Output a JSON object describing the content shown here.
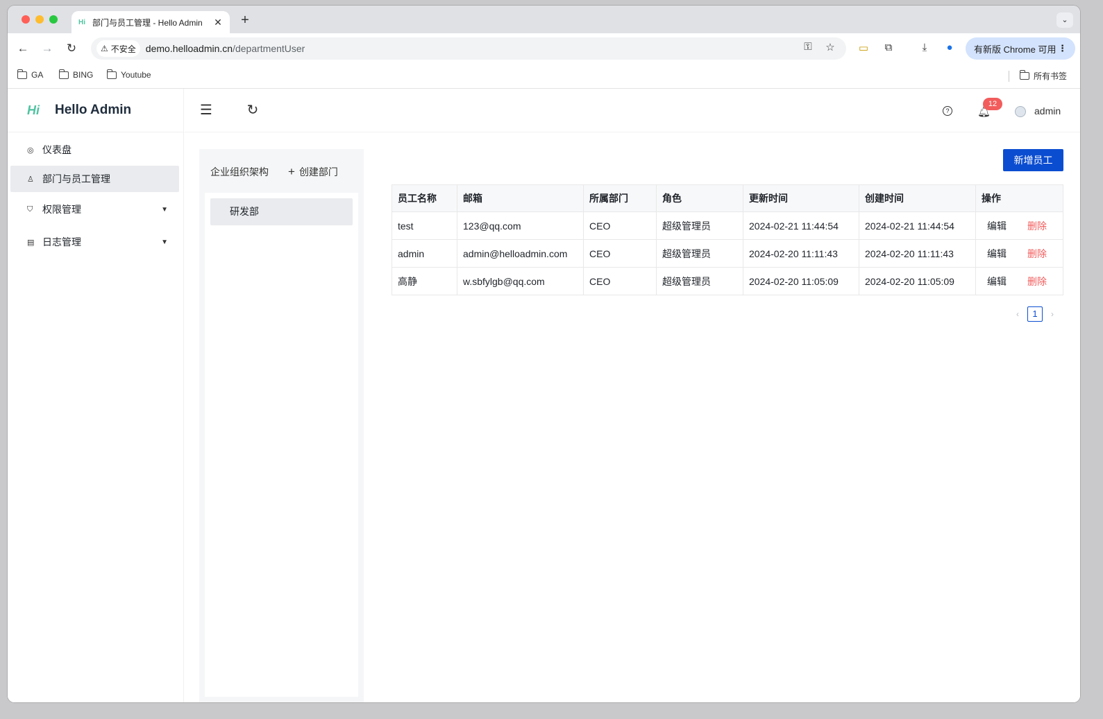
{
  "browser": {
    "tab_title": "部门与员工管理 - Hello Admin",
    "tab_favicon": "Hi",
    "insecure_label": "不安全",
    "url_host": "demo.helloadmin.cn",
    "url_path": "/departmentUser",
    "update_label": "有新版 Chrome 可用",
    "bookmarks": [
      "GA",
      "BING",
      "Youtube"
    ],
    "all_bookmarks": "所有书签"
  },
  "app": {
    "logo_mark": "Hi",
    "app_name": "Hello Admin",
    "menu": [
      {
        "label": "仪表盘",
        "icon": "dashboard-icon"
      },
      {
        "label": "部门与员工管理",
        "icon": "user-icon",
        "active": true
      },
      {
        "label": "权限管理",
        "icon": "shield-icon",
        "expandable": true
      },
      {
        "label": "日志管理",
        "icon": "log-icon",
        "expandable": true
      }
    ],
    "notification_count": "12",
    "username": "admin"
  },
  "org": {
    "title": "企业组织架构",
    "create_label": "创建部门",
    "departments": [
      "研发部"
    ]
  },
  "staff": {
    "add_label": "新增员工",
    "columns": [
      "员工名称",
      "邮箱",
      "所属部门",
      "角色",
      "更新时间",
      "创建时间",
      "操作"
    ],
    "rows": [
      {
        "name": "test",
        "email": "123@qq.com",
        "dept": "CEO",
        "role": "超级管理员",
        "updated": "2024-02-21 11:44:54",
        "created": "2024-02-21 11:44:54"
      },
      {
        "name": "admin",
        "email": "admin@helloadmin.com",
        "dept": "CEO",
        "role": "超级管理员",
        "updated": "2024-02-20 11:11:43",
        "created": "2024-02-20 11:11:43"
      },
      {
        "name": "高静",
        "email": "w.sbfylgb@qq.com",
        "dept": "CEO",
        "role": "超级管理员",
        "updated": "2024-02-20 11:05:09",
        "created": "2024-02-20 11:05:09"
      }
    ],
    "edit_label": "编辑",
    "delete_label": "删除",
    "current_page": "1"
  },
  "colors": {
    "primary": "#0b4dd1",
    "danger": "#f25c5c",
    "brand": "#4fc3a1"
  }
}
